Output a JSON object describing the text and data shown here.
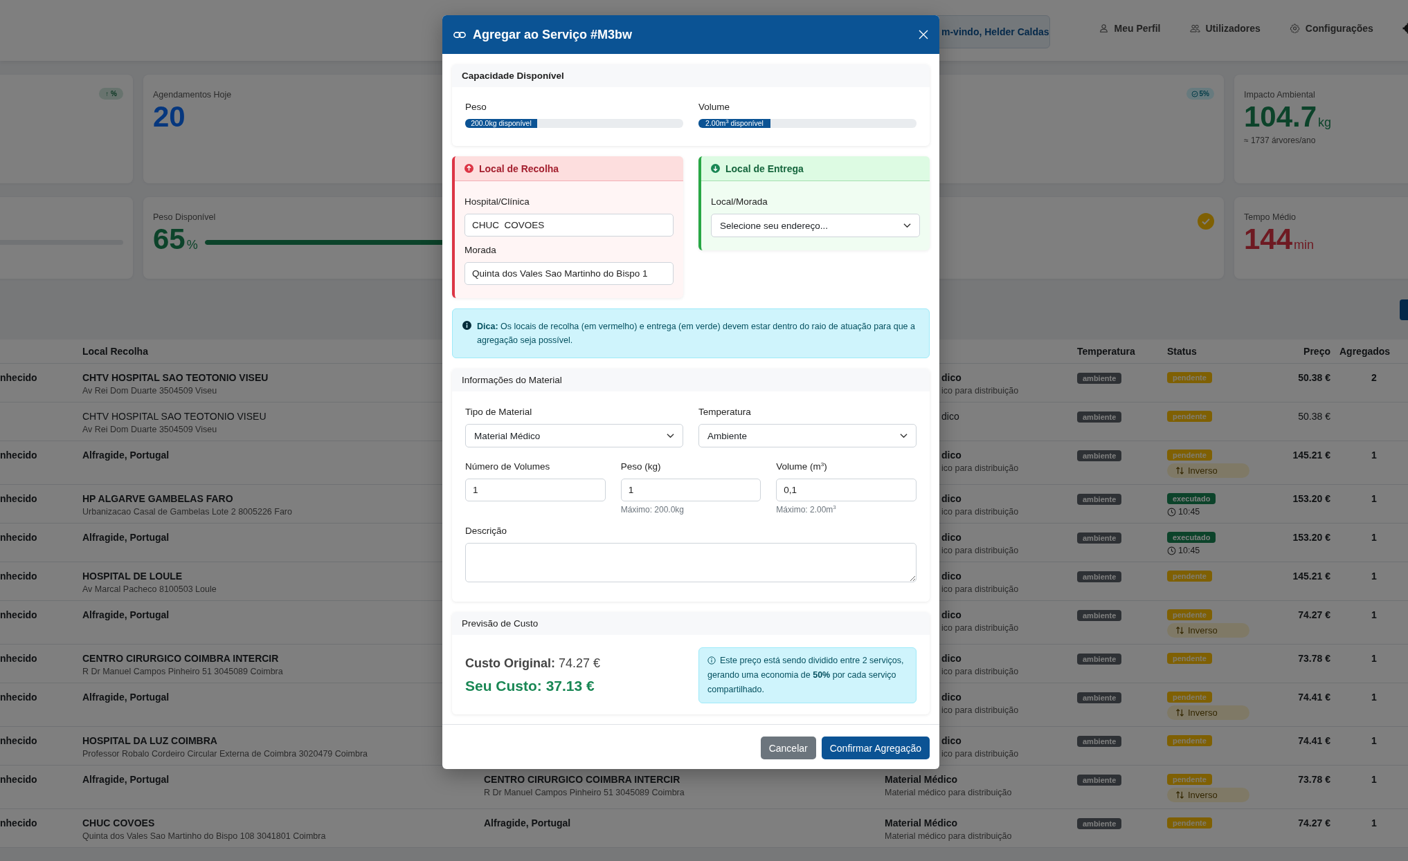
{
  "header": {
    "welcome": "m-vindo, Helder Caldas",
    "nav": [
      {
        "label": "Meu Perfil",
        "kind": "profile"
      },
      {
        "label": "Utilizadores",
        "kind": "users"
      },
      {
        "label": "Configurações",
        "kind": "settings"
      }
    ]
  },
  "stats": [
    [
      {
        "kind": "trend-badge",
        "badge": "↑ %"
      },
      {
        "kind": "primary-stat",
        "label": "Agendamentos Hoje",
        "value": "20"
      },
      {
        "kind": "info-badge",
        "badge": "5%"
      },
      {
        "kind": "success-stat",
        "label": "Impacto Ambiental",
        "value": "104.7",
        "unit": "kg",
        "note": "≈ 1737 árvores/ano"
      }
    ],
    [
      {
        "kind": "bar"
      },
      {
        "kind": "success-stat",
        "label": "Peso Disponível",
        "value": "65",
        "unit": "%",
        "level": 0.65
      },
      {
        "kind": "check"
      },
      {
        "kind": "danger-stat",
        "label": "Tempo Médio",
        "value": "144",
        "unit": "min"
      }
    ]
  ],
  "table": {
    "columns": [
      "Local Recolha",
      "Temperatura",
      "Status",
      "Preço",
      "Agregados"
    ],
    "rows": [
      {
        "covered": true,
        "bold": true,
        "col_1": "nhecido",
        "pickup": "CHTV HOSPITAL SAO TEOTONIO VISEU",
        "pickup_address": "Av Rei Dom Duarte 3504509 Viseu",
        "material": "dico",
        "material_note": "ico para distribuição",
        "temperature": "ambiente",
        "status": {
          "label": "pendente",
          "kind": "pending"
        },
        "price": "50.38 €",
        "aggregated": "2"
      },
      {
        "covered": true,
        "bold": false,
        "pickup": "CHTV HOSPITAL SAO TEOTONIO VISEU",
        "pickup_address": "Av Rei Dom Duarte 3504509 Viseu",
        "material": "dico",
        "temperature": "ambiente",
        "status": {
          "label": "pendente",
          "kind": "pending"
        },
        "price": "50.38 €"
      },
      {
        "covered": true,
        "bold": true,
        "col_1": "nhecido",
        "pickup": "Alfragide, Portugal",
        "material": "dico",
        "material_note": "ico para distribuição",
        "temperature": "ambiente",
        "status": {
          "label": "pendente",
          "kind": "pending"
        },
        "extra": {
          "kind": "inverse",
          "label": "Inverso"
        },
        "price": "145.21 €",
        "aggregated": "1"
      },
      {
        "covered": true,
        "bold": true,
        "col_1": "nhecido",
        "pickup": "HP ALGARVE GAMBELAS FARO",
        "pickup_address": "Urbanizacao Casal de Gambelas Lote 2 8005226 Faro",
        "material": "dico",
        "material_note": "ico para distribuição",
        "temperature": "ambiente",
        "status": {
          "label": "executado",
          "kind": "done"
        },
        "extra": {
          "kind": "time",
          "label": "10:45"
        },
        "price": "153.20 €",
        "aggregated": "1"
      },
      {
        "covered": true,
        "bold": true,
        "col_1": "nhecido",
        "pickup": "Alfragide, Portugal",
        "material": "dico",
        "material_note": "ico para distribuição",
        "temperature": "ambiente",
        "status": {
          "label": "executado",
          "kind": "done"
        },
        "extra": {
          "kind": "time",
          "label": "10:45"
        },
        "price": "153.20 €",
        "aggregated": "1"
      },
      {
        "covered": true,
        "bold": true,
        "col_1": "nhecido",
        "pickup": "HOSPITAL DE LOULE",
        "pickup_address": "Av Marcal Pacheco 8100503 Loule",
        "material": "dico",
        "material_note": "ico para distribuição",
        "temperature": "ambiente",
        "status": {
          "label": "pendente",
          "kind": "pending"
        },
        "price": "145.21 €",
        "aggregated": "1"
      },
      {
        "covered": true,
        "bold": true,
        "col_1": "nhecido",
        "pickup": "Alfragide, Portugal",
        "material": "dico",
        "material_note": "ico para distribuição",
        "temperature": "ambiente",
        "status": {
          "label": "pendente",
          "kind": "pending"
        },
        "extra": {
          "kind": "inverse",
          "label": "Inverso"
        },
        "price": "74.27 €",
        "aggregated": "1"
      },
      {
        "covered": true,
        "bold": true,
        "col_1": "nhecido",
        "pickup": "CENTRO CIRURGICO COIMBRA INTERCIR",
        "pickup_address": "R Dr Manuel Campos Pinheiro 51 3045089 Coimbra",
        "material": "dico",
        "material_note": "ico para distribuição",
        "temperature": "ambiente",
        "status": {
          "label": "pendente",
          "kind": "pending"
        },
        "price": "73.78 €",
        "aggregated": "1"
      },
      {
        "covered": true,
        "bold": true,
        "col_1": "nhecido",
        "pickup": "Alfragide, Portugal",
        "material": "dico",
        "material_note": "ico para distribuição",
        "temperature": "ambiente",
        "status": {
          "label": "pendente",
          "kind": "pending"
        },
        "extra": {
          "kind": "inverse",
          "label": "Inverso"
        },
        "price": "74.41 €",
        "aggregated": "1"
      },
      {
        "covered": true,
        "bold": true,
        "col_1": "nhecido",
        "pickup": "HOSPITAL DA LUZ COIMBRA",
        "pickup_address": "Professor Robalo Cordeiro Circular Externa de Coimbra 3020479 Coimbra",
        "material": "dico",
        "material_note": "ico para distribuição",
        "temperature": "ambiente",
        "status": {
          "label": "pendente",
          "kind": "pending"
        },
        "price": "74.41 €",
        "aggregated": "1"
      },
      {
        "covered": false,
        "bold": true,
        "col_1": "nhecido",
        "pickup": "Alfragide, Portugal",
        "delivery": "CENTRO CIRURGICO COIMBRA INTERCIR",
        "delivery_address": "R Dr Manuel Campos Pinheiro 51 3045089 Coimbra",
        "material": "Material Médico",
        "material_note": "Material médico para distribuição",
        "temperature": "ambiente",
        "status": {
          "label": "pendente",
          "kind": "pending"
        },
        "extra": {
          "kind": "inverse",
          "label": "Inverso"
        },
        "price": "73.78 €",
        "aggregated": "1"
      },
      {
        "covered": false,
        "bold": true,
        "col_1": "nhecido",
        "pickup": "CHUC COVOES",
        "pickup_address": "Quinta dos Vales Sao Martinho do Bispo 108 3041801 Coimbra",
        "delivery": "Alfragide, Portugal",
        "material": "Material Médico",
        "material_note": "Material médico para distribuição",
        "temperature": "ambiente",
        "status": {
          "label": "pendente",
          "kind": "pending"
        },
        "price": "74.27 €",
        "aggregated": "1"
      }
    ]
  },
  "modal": {
    "title": "Agregar ao Serviço #M3bw",
    "capacity": {
      "title": "Capacidade Disponível",
      "meters": [
        {
          "label": "Peso",
          "reading": "200.0kg disponível",
          "level": 0.33
        },
        {
          "label": "Volume",
          "reading": "2.00m$^{3}$ disponível",
          "level": 0.33
        }
      ]
    },
    "pickup": {
      "title": "Local de Recolha",
      "fields": [
        {
          "label": "Hospital/Clínica",
          "value": "CHUC  COVOES"
        },
        {
          "label": "Morada",
          "value": "Quinta dos Vales Sao Martinho do Bispo 1"
        }
      ]
    },
    "delivery": {
      "title": "Local de Entrega",
      "label": "Local/Morada",
      "value": "Selecione seu endereço..."
    },
    "tip": "**Dica:** Os locais de recolha (em vermelho) e entrega (em verde) devem estar dentro do raio de atuação para que a agregação seja possível.",
    "material": {
      "title": "Informações do Material",
      "selects": [
        {
          "label": "Tipo de Material",
          "value": "Material Médico"
        },
        {
          "label": "Temperatura",
          "value": "Ambiente"
        }
      ],
      "inputs": [
        {
          "label": "Número de Volumes",
          "value": "1"
        },
        {
          "label": "Peso (kg)",
          "value": "1",
          "hint": "Máximo: 200.0kg"
        },
        {
          "label": "Volume (m$^{3}$)",
          "value": "0,1",
          "hint": "Máximo: 2.00m$^{3}$"
        }
      ],
      "description_label": "Descrição"
    },
    "cost": {
      "title": "Previsão de Custo",
      "original": "**Custo Original:** 74.27 €",
      "yours": "Seu Custo: 37.13 €",
      "note": "Este preço está sendo dividido entre 2 serviços, gerando uma economia de **50%** por cada serviço compartilhado."
    },
    "buttons": [
      {
        "label": "Cancelar",
        "kind": "secondary"
      },
      {
        "label": "Confirmar Agregação",
        "kind": "primary"
      }
    ]
  }
}
